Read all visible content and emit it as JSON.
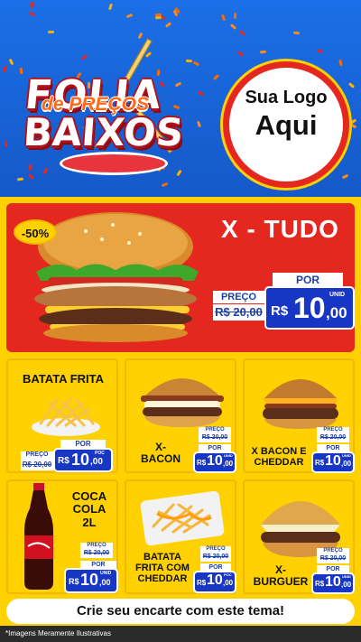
{
  "header": {
    "title_line1": "FOLIA",
    "title_line2": "de PREÇOS",
    "title_line3": "BAIXOS",
    "logo_line1": "Sua Logo",
    "logo_line2": "Aqui"
  },
  "hero": {
    "discount": "-50%",
    "name": "X - TUDO",
    "price_label": "PREÇO",
    "old_price": "R$ 20,00",
    "por_label": "POR",
    "currency": "R$",
    "price_int": "10",
    "price_dec": ",00",
    "unit_label": "UNID"
  },
  "products": [
    {
      "name": "BATATA FRITA",
      "price_label": "PREÇO",
      "old_price": "R$ 20,00",
      "por_label": "POR",
      "currency": "R$",
      "price_int": "10",
      "price_dec": ",00",
      "unit_label": "POC"
    },
    {
      "name": "X-\nBACON",
      "price_label": "PREÇO",
      "old_price": "R$ 20,00",
      "por_label": "POR",
      "currency": "R$",
      "price_int": "10",
      "price_dec": ",00",
      "unit_label": "UNID"
    },
    {
      "name": "X BACON E\nCHEDDAR",
      "price_label": "PREÇO",
      "old_price": "R$ 20,00",
      "por_label": "POR",
      "currency": "R$",
      "price_int": "10",
      "price_dec": ",00",
      "unit_label": "UNID"
    },
    {
      "name": "COCA\nCOLA\n2L",
      "price_label": "PREÇO",
      "old_price": "R$ 20,00",
      "por_label": "POR",
      "currency": "R$",
      "price_int": "10",
      "price_dec": ",00",
      "unit_label": "UNID"
    },
    {
      "name": "BATATA\nFRITA COM\nCHEDDAR",
      "price_label": "PREÇO",
      "old_price": "R$ 20,00",
      "por_label": "POR",
      "currency": "R$",
      "price_int": "10",
      "price_dec": ",00",
      "unit_label": "POC"
    },
    {
      "name": "X-\nBURGUER",
      "price_label": "PREÇO",
      "old_price": "R$ 20,00",
      "por_label": "POR",
      "currency": "R$",
      "price_int": "10",
      "price_dec": ",00",
      "unit_label": "UNID"
    }
  ],
  "footer": {
    "cta": "Crie seu encarte com este tema!",
    "disclaimer": "*Imagens Meramente Ilustrativas"
  },
  "colors": {
    "header_blue": "#1565d8",
    "accent_red": "#e4271f",
    "accent_yellow": "#ffd100",
    "price_blue": "#1736c4"
  }
}
